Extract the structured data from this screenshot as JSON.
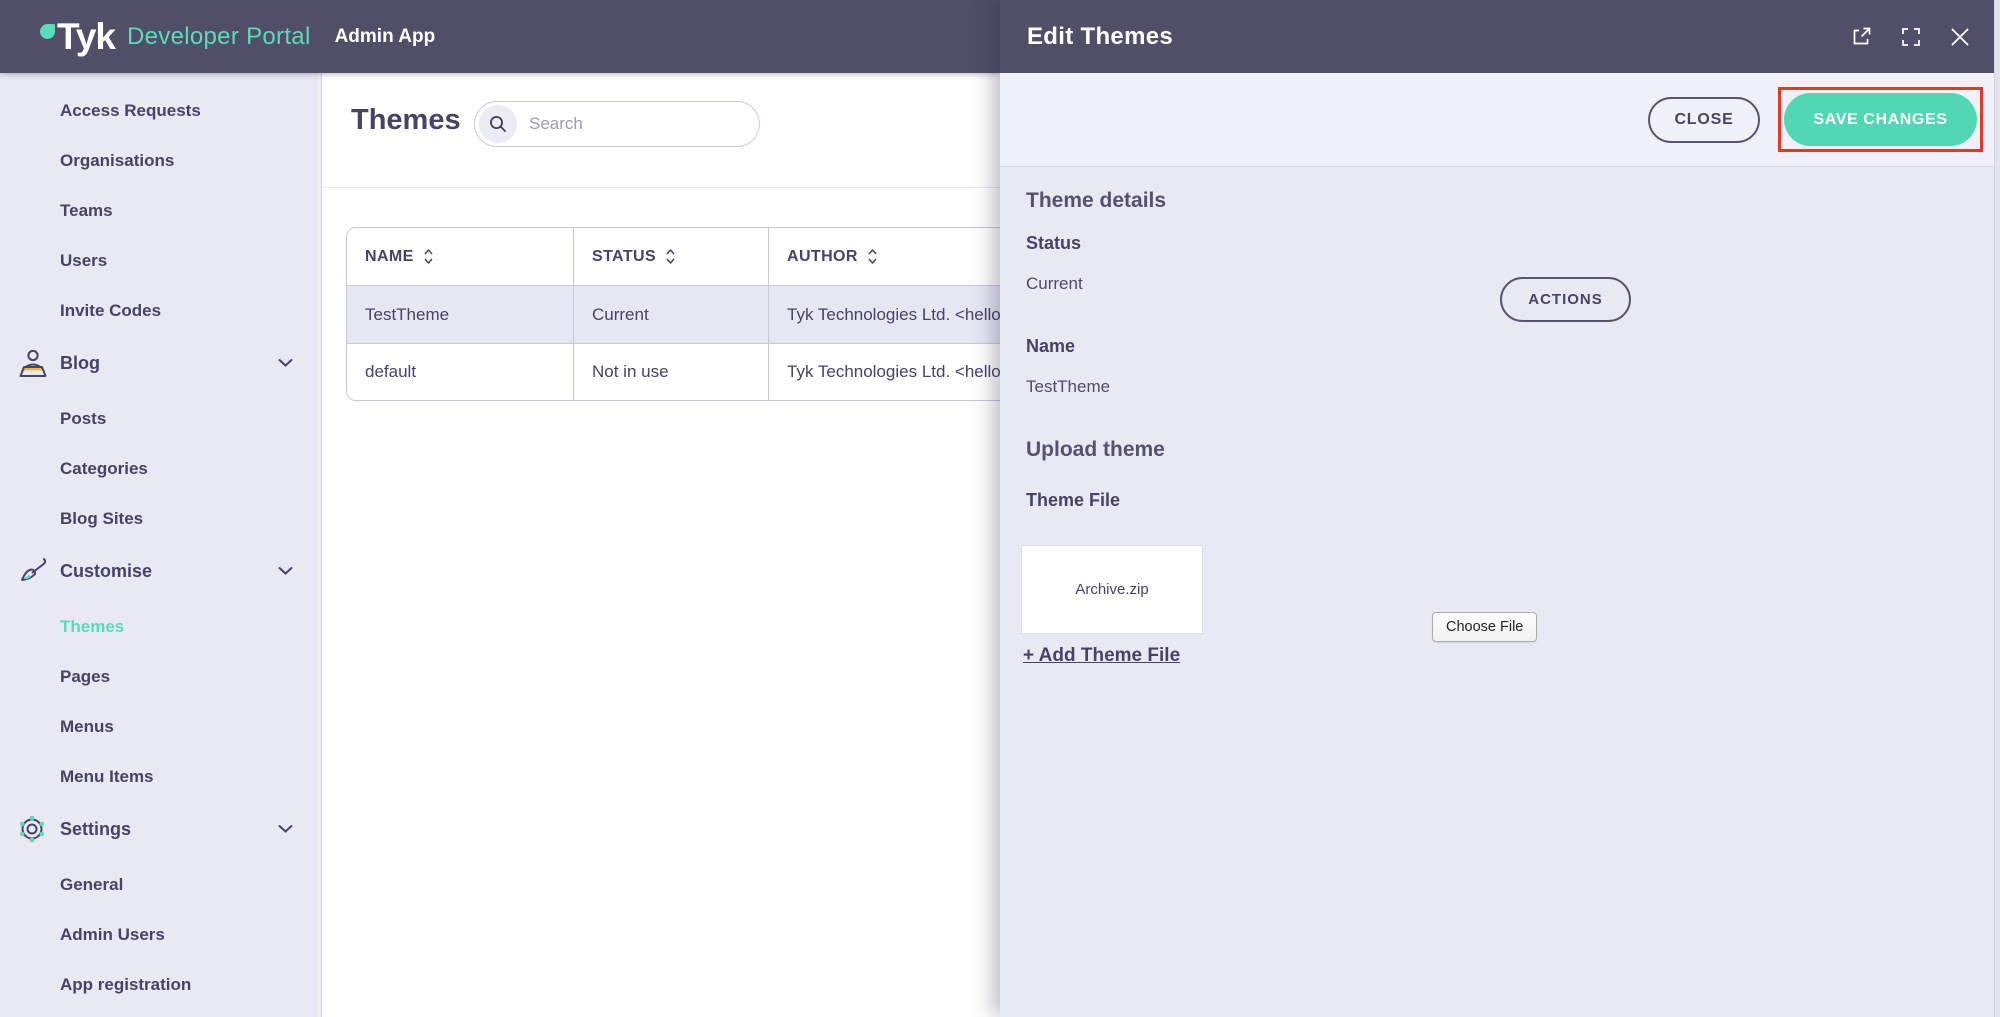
{
  "navbar": {
    "logo_text": "Tyk",
    "logo_subtitle": "Developer Portal",
    "app_label": "Admin App"
  },
  "sidebar": {
    "items": [
      {
        "label": "Access Requests"
      },
      {
        "label": "Organisations"
      },
      {
        "label": "Teams"
      },
      {
        "label": "Users"
      },
      {
        "label": "Invite Codes"
      },
      {
        "label": "Blog",
        "icon": "blog-icon",
        "expandable": true
      },
      {
        "label": "Posts"
      },
      {
        "label": "Categories"
      },
      {
        "label": "Blog Sites"
      },
      {
        "label": "Customise",
        "icon": "paintbrush-icon",
        "expandable": true
      },
      {
        "label": "Themes",
        "active": true
      },
      {
        "label": "Pages"
      },
      {
        "label": "Menus"
      },
      {
        "label": "Menu Items"
      },
      {
        "label": "Settings",
        "icon": "gear-icon",
        "expandable": true
      },
      {
        "label": "General"
      },
      {
        "label": "Admin Users"
      },
      {
        "label": "App registration"
      }
    ]
  },
  "main": {
    "title": "Themes",
    "search": {
      "placeholder": "Search"
    },
    "table": {
      "columns": [
        {
          "label": "NAME"
        },
        {
          "label": "STATUS"
        },
        {
          "label": "AUTHOR"
        }
      ],
      "rows": [
        {
          "name": "TestTheme",
          "status": "Current",
          "author": "Tyk Technologies Ltd. <hello",
          "selected": true
        },
        {
          "name": "default",
          "status": "Not in use",
          "author": "Tyk Technologies Ltd. <hello",
          "selected": false
        }
      ]
    }
  },
  "drawer": {
    "title": "Edit Themes",
    "buttons": {
      "close": "CLOSE",
      "save": "SAVE CHANGES",
      "actions": "ACTIONS"
    },
    "theme_details": {
      "heading": "Theme details",
      "status_label": "Status",
      "status_value": "Current",
      "name_label": "Name",
      "name_value": "TestTheme"
    },
    "upload": {
      "heading": "Upload theme",
      "file_label": "Theme File",
      "file_name": "Archive.zip",
      "choose_file": "Choose File",
      "add_theme_file": "+ Add Theme File"
    }
  },
  "colors": {
    "header_bg": "#514E68",
    "accent_teal": "#50D7B4",
    "active_link": "#59DAB8",
    "sidebar_bg": "#E9E9F4",
    "text_dark": "#474364",
    "selected_row": "#E7E7F4",
    "annotation_red": "#E7372C",
    "logo_yellow": "#E9B840"
  }
}
